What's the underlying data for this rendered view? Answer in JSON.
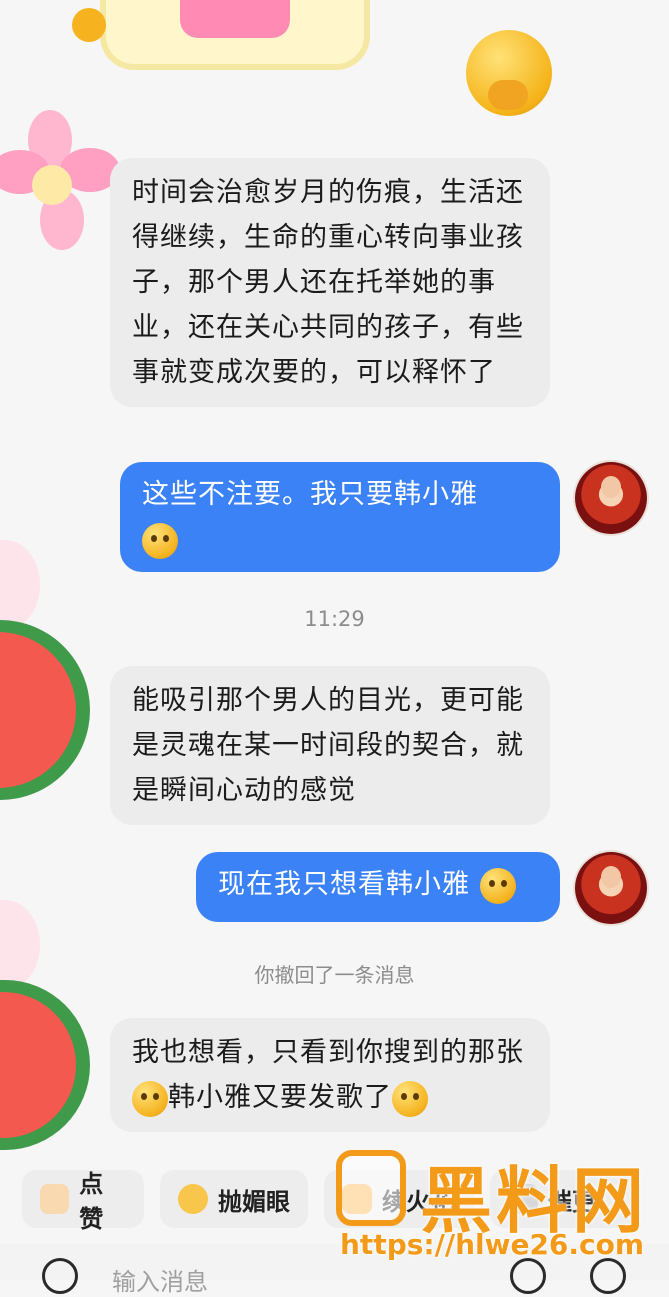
{
  "messages": [
    {
      "kind": "incoming",
      "text": "时间会治愈岁月的伤痕，生活还得继续，生命的重心转向事业孩子，那个男人还在托举她的事业，还在关心共同的孩子，有些事就变成次要的，可以释怀了"
    },
    {
      "kind": "outgoing",
      "text": "这些不注要。我只要韩小雅",
      "emoji": "crying-laughing-emoji"
    },
    {
      "kind": "time",
      "text": "11:29"
    },
    {
      "kind": "incoming",
      "text": "能吸引那个男人的目光，更可能是灵魂在某一时间段的契合，就是瞬间心动的感觉"
    },
    {
      "kind": "outgoing",
      "text": "现在我只想看韩小雅",
      "emoji": "pleading-emoji"
    },
    {
      "kind": "system",
      "text": "你撤回了一条消息"
    },
    {
      "kind": "incoming",
      "text_a": "我也想看，只看到你搜到的那张",
      "text_b": "韩小雅又要发歌了",
      "emoji_a": "crying-laughing-emoji",
      "emoji_b": "winking-tongue-emoji"
    }
  ],
  "quick_replies": [
    {
      "label": "点赞",
      "icon": "thumbs-up-icon"
    },
    {
      "label": "抛媚眼",
      "icon": "wink-face-icon"
    },
    {
      "label": "续火花",
      "icon": "spark-icon"
    },
    {
      "label": "催更",
      "icon": "more-icon"
    }
  ],
  "input": {
    "placeholder": "输入消息"
  },
  "watermark": {
    "brand": "黑料网",
    "url": "https://hlwe26.com"
  },
  "colors": {
    "outgoing_bubble": "#3b82f6",
    "incoming_bubble": "#ececec",
    "background": "#f6f6f6",
    "watermark": "#f39a18"
  }
}
